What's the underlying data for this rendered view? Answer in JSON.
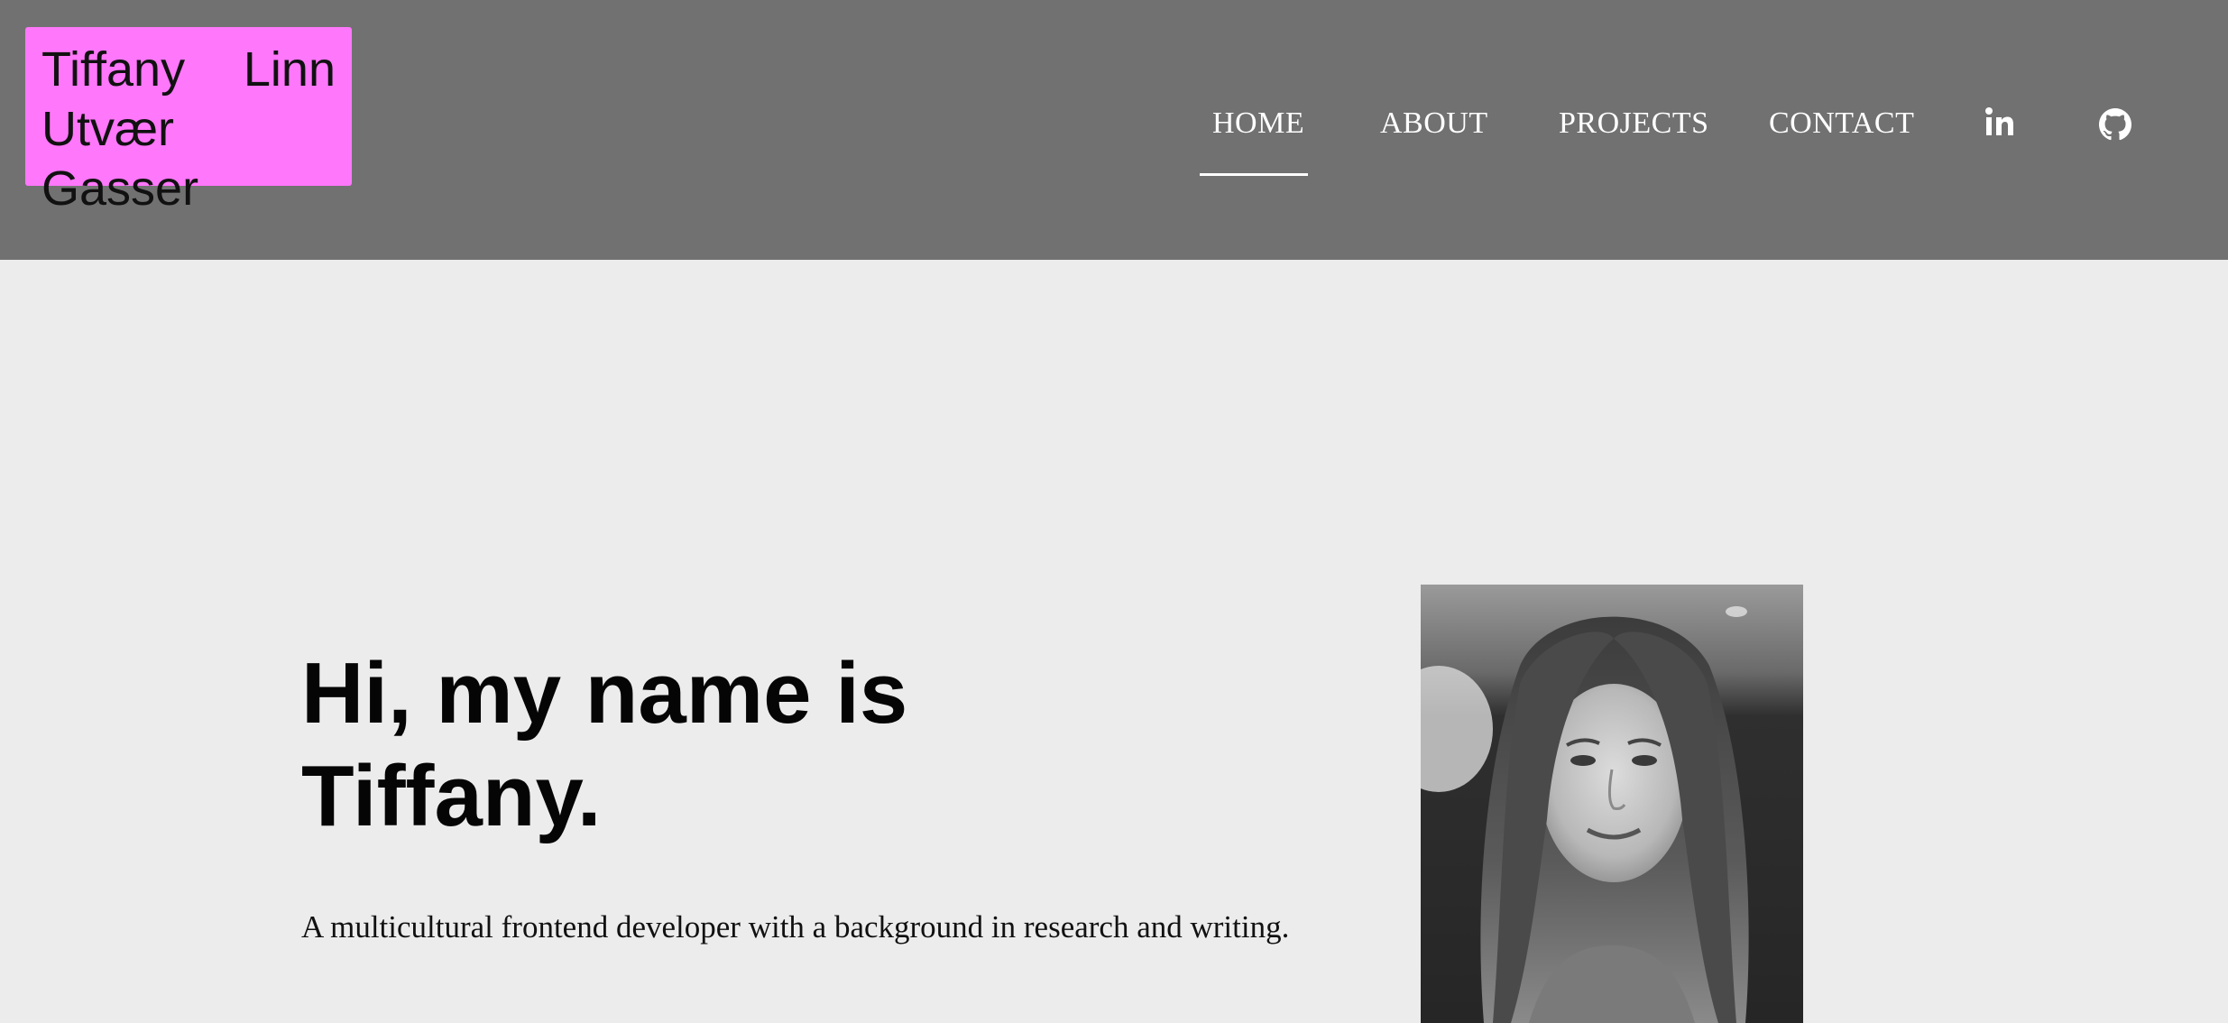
{
  "header": {
    "logo_line1": "Tiffany Linn",
    "logo_line2": "Utvær Gasser",
    "logo_color": "#ff77fa",
    "background_color": "#717171"
  },
  "nav": {
    "items": [
      {
        "label": "HOME",
        "active": true
      },
      {
        "label": "ABOUT",
        "active": false
      },
      {
        "label": "PROJECTS",
        "active": false
      },
      {
        "label": "CONTACT",
        "active": false
      }
    ],
    "social": [
      {
        "icon": "linkedin-icon",
        "label": "in"
      },
      {
        "icon": "github-icon"
      }
    ]
  },
  "hero": {
    "title_line1": "Hi, my name is",
    "title_line2": "Tiffany.",
    "subtitle": "A multicultural frontend developer with a background in research and writing."
  },
  "photo": {
    "icon": "profile-photo"
  }
}
